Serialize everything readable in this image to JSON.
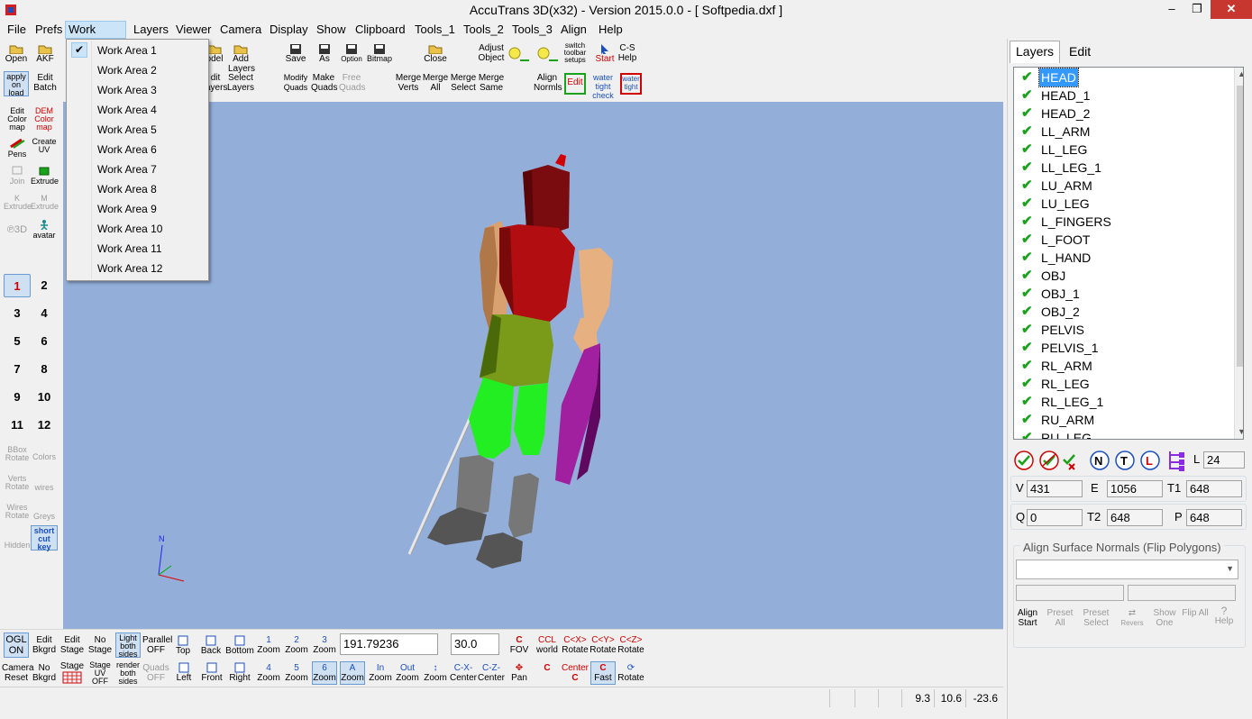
{
  "window": {
    "title": "AccuTrans 3D(x32) - Version 2015.0.0 - [ Softpedia.dxf ]",
    "min": "–",
    "max": "❐",
    "close": "✕"
  },
  "menu": [
    "File",
    "Prefs",
    "Work Area",
    "Layers",
    "Viewer",
    "Camera",
    "Display",
    "Show",
    "Clipboard",
    "Tools_1",
    "Tools_2",
    "Tools_3",
    "Align",
    "Help"
  ],
  "workarea_menu": {
    "items": [
      "Work Area 1",
      "Work Area 2",
      "Work Area 3",
      "Work Area 4",
      "Work Area 5",
      "Work Area 6",
      "Work Area 7",
      "Work Area 8",
      "Work Area 9",
      "Work Area 10",
      "Work Area 11",
      "Work Area 12"
    ],
    "checked": "Work Area 1"
  },
  "toolbar": {
    "open": "Open",
    "akf": "AKF",
    "apply": "apply on load",
    "edit_batch": "Edit Batch",
    "model": "odel",
    "edit_layers": "dit ayers",
    "add_layers": "Add Layers",
    "select_layers": "Select Layers",
    "save": "Save",
    "save_as": "As",
    "option": "Option",
    "bitmap": "Bitmap",
    "close": "Close",
    "modify_quads": "Modify Quads",
    "make_quads": "Make Quads",
    "free_quads": "Free Quads",
    "merge_verts": "Merge Verts",
    "merge_all": "Merge All",
    "merge_select": "Merge Select",
    "merge_same": "Merge Same",
    "adjust_object": "Adjust Object",
    "align_normals": "Align Normls",
    "edit": "Edit",
    "switch_toolbar": "switch toolbar setups",
    "start": "Start",
    "cs_help": "C-S Help",
    "water_tight": "water tight check",
    "water_tight2": "water tight"
  },
  "left_tools": {
    "edit_color_map": "Edit Color map",
    "dem_color_map": "DEM Color map",
    "pens": "Pens",
    "create_uv": "Create UV",
    "join": "Join",
    "extrude": "Extrude",
    "k_extrude": "K Extrude",
    "m_extrude": "M Extrude",
    "to3d": "℗3D",
    "avatar": "avatar",
    "bbox_rotate": "BBox Rotate",
    "colors": "Colors",
    "verts_rotate": "Verts Rotate",
    "wires": "wires",
    "wires_rotate": "Wires Rotate",
    "greys": "Greys",
    "hidden": "Hidden",
    "shortcut": "short cut key"
  },
  "workareas": [
    "1",
    "2",
    "3",
    "4",
    "5",
    "6",
    "7",
    "8",
    "9",
    "10",
    "11",
    "12"
  ],
  "bottom": {
    "ogl_on": "OGL ON",
    "edit_bkgrd": "Edit Bkgrd",
    "edit_stage": "Edit Stage",
    "no_stage": "No Stage",
    "light_both_sides": "Light both sides",
    "parallel_off": "Parallel OFF",
    "top": "Top",
    "back": "Back",
    "bottom": "Bottom",
    "zoom": "Zoom",
    "zoom_value": "191.79236",
    "fov_value": "30.0",
    "fov": "FOV",
    "world": "world",
    "rotate": "Rotate",
    "camera_reset": "Camera Reset",
    "no_bkgrd": "No Bkgrd",
    "stage": "Stage",
    "stage_uv_off": "Stage UV OFF",
    "render_both_sides": "render both sides",
    "quads_off": "Quads OFF",
    "left": "Left",
    "front": "Front",
    "right": "Right",
    "center": "Center",
    "pan": "Pan",
    "fast": "Fast",
    "z1": "1",
    "z2": "2",
    "z3": "3",
    "z4": "4",
    "z5": "5",
    "z6": "6",
    "in": "In",
    "out": "Out",
    "cx": "C<X>",
    "cy": "C<Y>",
    "cz": "C<Z>",
    "ccl": "CCL",
    "cmx": "C-X-",
    "cmz": "C-Z-"
  },
  "status": {
    "x": "9.3",
    "y": "10.6",
    "z": "-23.6"
  },
  "panel": {
    "tabs": [
      "Layers",
      "Edit"
    ],
    "layers": [
      "HEAD",
      "HEAD_1",
      "HEAD_2",
      "LL_ARM",
      "LL_LEG",
      "LL_LEG_1",
      "LU_ARM",
      "LU_LEG",
      "L_FINGERS",
      "L_FOOT",
      "L_HAND",
      "OBJ",
      "OBJ_1",
      "OBJ_2",
      "PELVIS",
      "PELVIS_1",
      "RL_ARM",
      "RL_LEG",
      "RL_LEG_1",
      "RU_ARM",
      "RU_LEG"
    ],
    "selected_layer": "HEAD",
    "L_label": "L",
    "L_value": "24",
    "V_label": "V",
    "V_value": "431",
    "E_label": "E",
    "E_value": "1056",
    "T1_label": "T1",
    "T1_value": "648",
    "Q_label": "Q",
    "Q_value": "0",
    "T2_label": "T2",
    "T2_value": "648",
    "P_label": "P",
    "P_value": "648",
    "align_title": "Align Surface Normals (Flip Polygons)",
    "align_start": "Align Start",
    "preset_all": "Preset All",
    "preset_select": "Preset Select",
    "revers": "Revers",
    "show_one": "Show One",
    "flip_all": "Flip All",
    "help": "Help"
  },
  "axis": {
    "north": "N"
  },
  "colors": {
    "viewport_bg": "#93aed9",
    "selection": "#3399ff",
    "check": "#1aa21a",
    "close": "#c7372f"
  }
}
